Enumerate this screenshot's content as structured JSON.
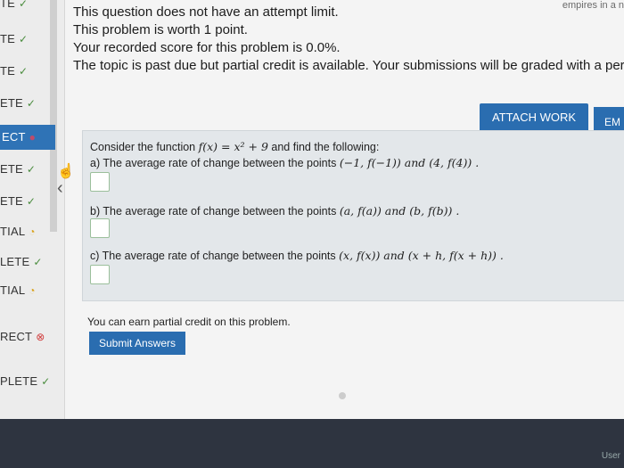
{
  "sidebar": {
    "items": [
      {
        "label": "TE",
        "status": "✓"
      },
      {
        "label": "TE",
        "status": "✓"
      },
      {
        "label": "TE",
        "status": "✓"
      },
      {
        "label": "ETE",
        "status": "✓"
      },
      {
        "label": "ECT",
        "status": "●"
      },
      {
        "label": "ETE",
        "status": "✓"
      },
      {
        "label": "ETE",
        "status": "✓"
      },
      {
        "label": "TIAL",
        "status": "◔"
      },
      {
        "label": "LETE",
        "status": "✓"
      },
      {
        "label": "TIAL",
        "status": "◔"
      },
      {
        "label": "RECT",
        "status": "⊗"
      },
      {
        "label": "PLETE",
        "status": "✓"
      }
    ]
  },
  "info": {
    "line1": "This question does not have an attempt limit.",
    "line2": "This problem is worth 1 point.",
    "line3": "Your recorded score for this problem is 0.0%.",
    "line4": "The topic is past due but partial credit is available. Your submissions will be graded with a per"
  },
  "topright_text": "empires in a n",
  "buttons": {
    "attach": "ATTACH WORK",
    "email": "EM",
    "submit": "Submit Answers"
  },
  "problem": {
    "intro_prefix": "Consider the function",
    "intro_func": "f(x) = x² + 9",
    "intro_suffix": "and find the following:",
    "a_text": "a) The average rate of change between the points",
    "a_points": "(−1, f(−1))  and  (4, f(4)) .",
    "b_text": "b) The average rate of change between the points",
    "b_points": "(a, f(a))  and  (b, f(b)) .",
    "c_text": "c) The average rate of change between the points",
    "c_points": "(x, f(x))  and  (x + h, f(x + h)) ."
  },
  "partial_credit": "You can earn partial credit on this problem.",
  "footer_user": "User"
}
